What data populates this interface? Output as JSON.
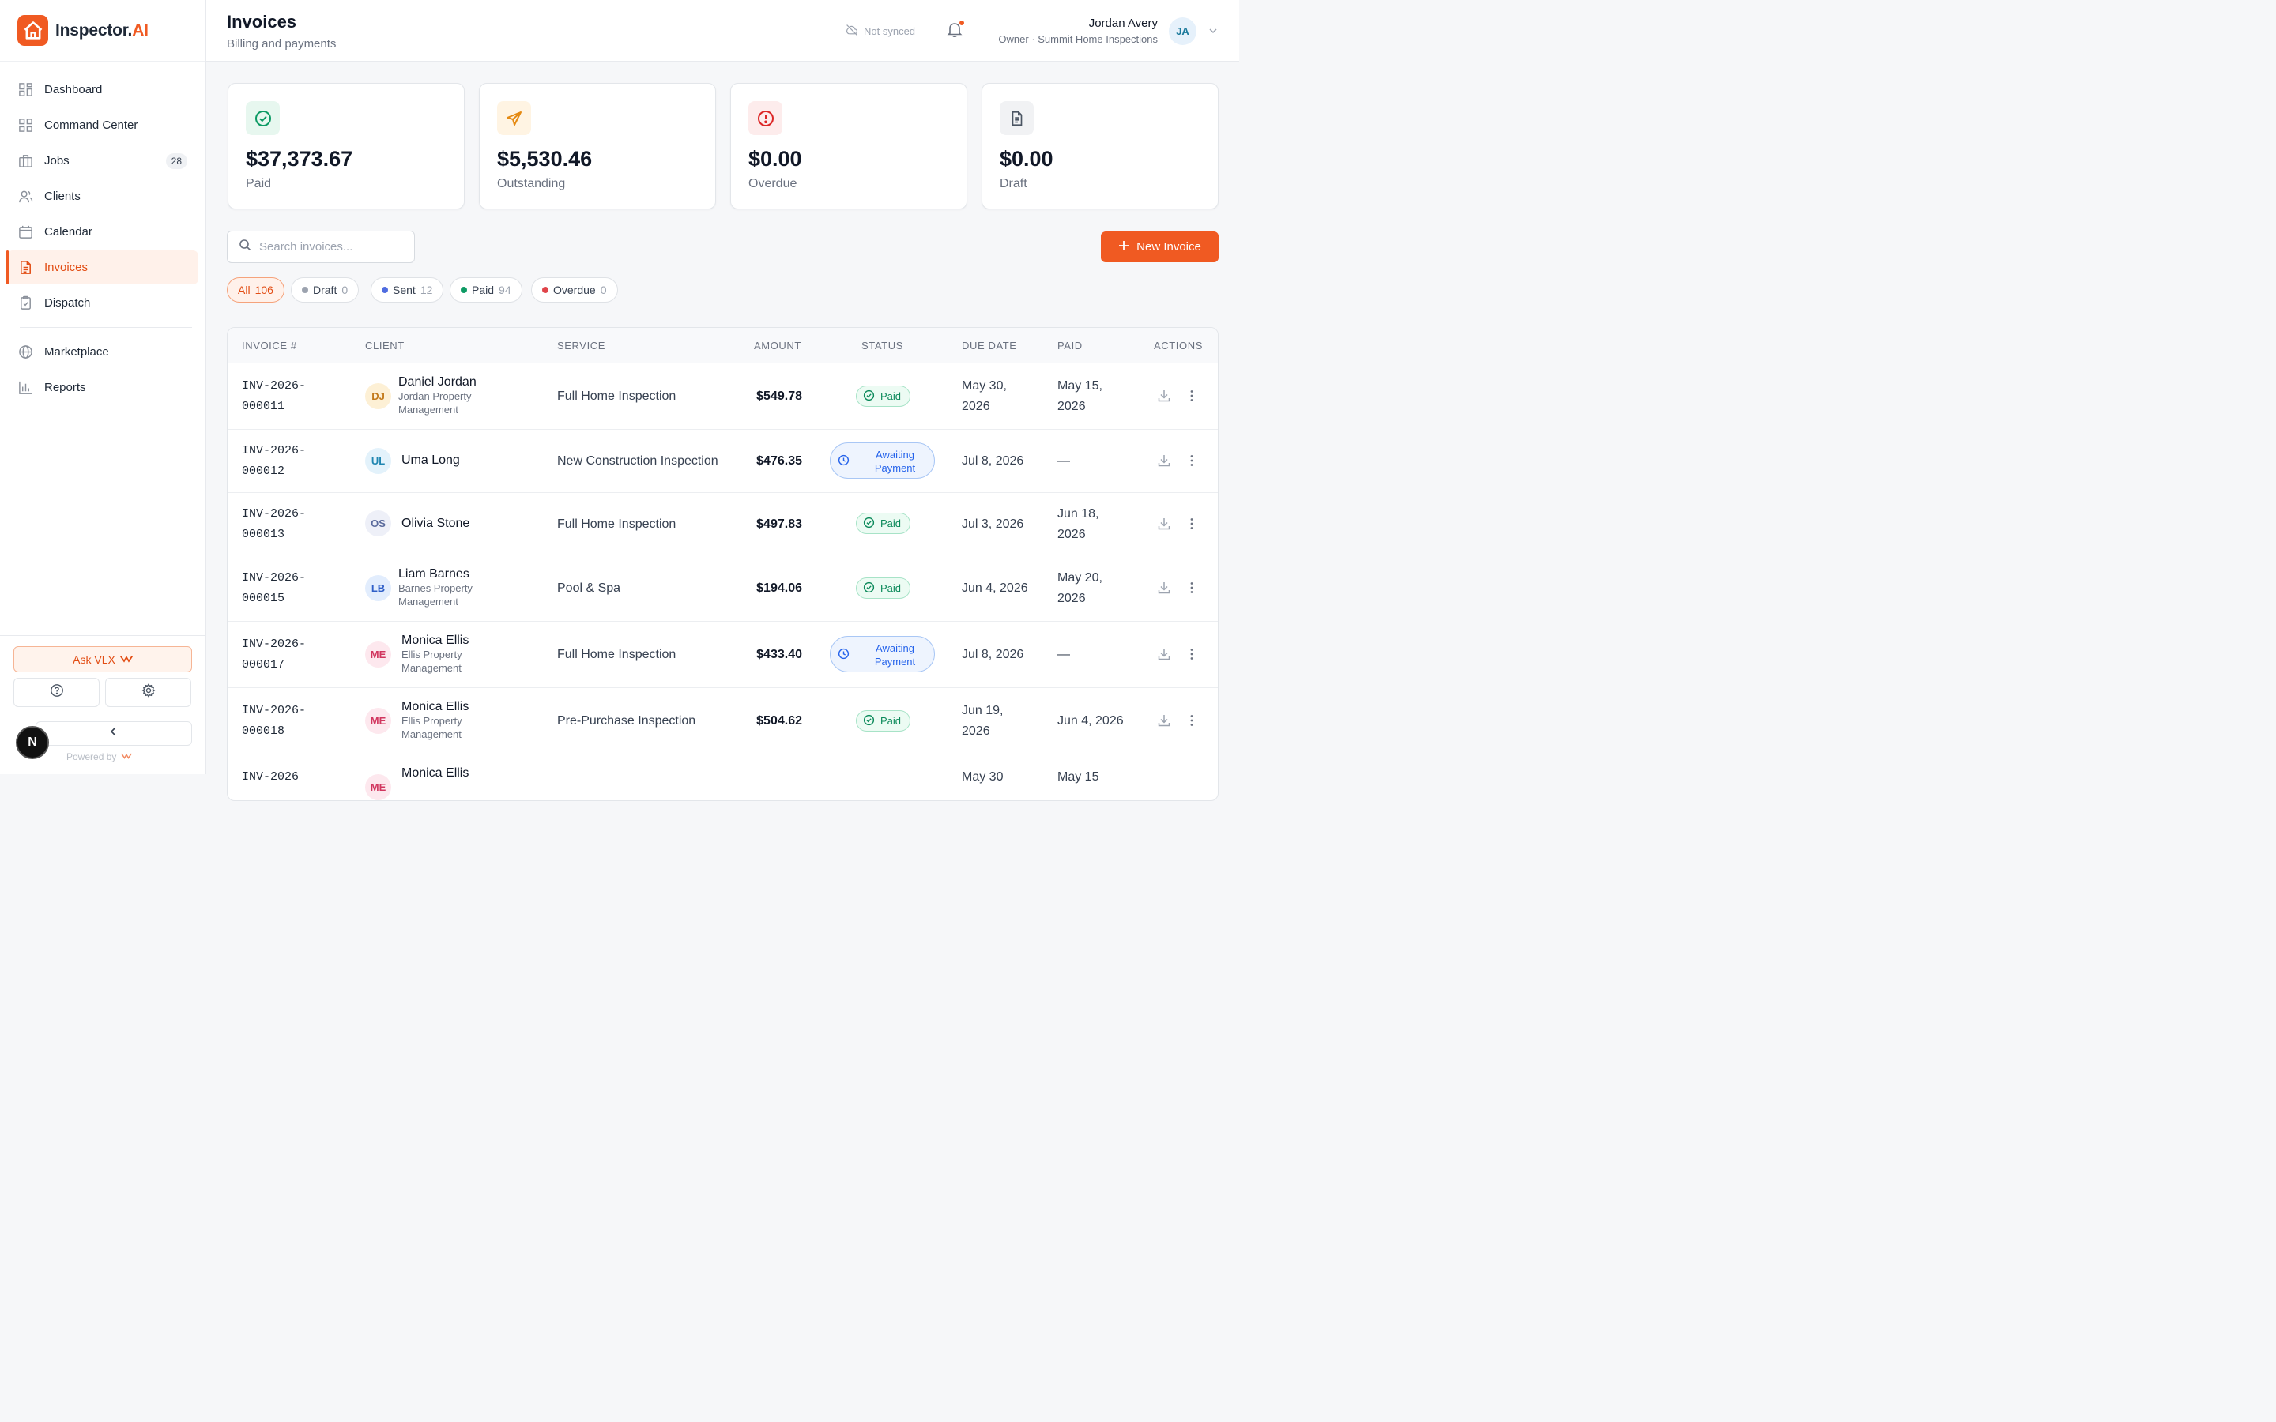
{
  "brand": {
    "name": "Inspector.",
    "suffix": "AI"
  },
  "sidebar": {
    "items": [
      {
        "label": "Dashboard",
        "icon": "grid-icon"
      },
      {
        "label": "Command Center",
        "icon": "grid-icon"
      },
      {
        "label": "Jobs",
        "icon": "building-icon",
        "badge": "28"
      },
      {
        "label": "Clients",
        "icon": "users-icon"
      },
      {
        "label": "Calendar",
        "icon": "calendar-icon"
      },
      {
        "label": "Invoices",
        "icon": "file-icon",
        "active": true
      },
      {
        "label": "Dispatch",
        "icon": "clipboard-icon"
      },
      {
        "label": "Marketplace",
        "icon": "globe-icon"
      },
      {
        "label": "Reports",
        "icon": "bar-chart-icon"
      }
    ],
    "ask_label": "Ask VLX",
    "avatar_initial": "N",
    "powered_by": "Powered by"
  },
  "header": {
    "title": "Invoices",
    "subtitle": "Billing and payments",
    "sync_status": "Not synced",
    "user_name": "Jordan Avery",
    "user_role": "Owner · Summit Home Inspections",
    "user_initials": "JA"
  },
  "stats": [
    {
      "amount": "$37,373.67",
      "label": "Paid",
      "icon": "check-circle-icon",
      "color": "#0d9a64",
      "bg": "#e7f7ef"
    },
    {
      "amount": "$5,530.46",
      "label": "Outstanding",
      "icon": "send-icon",
      "color": "#e58a12",
      "bg": "#fff4e3"
    },
    {
      "amount": "$0.00",
      "label": "Overdue",
      "icon": "alert-circle-icon",
      "color": "#dc2626",
      "bg": "#fdecec"
    },
    {
      "amount": "$0.00",
      "label": "Draft",
      "icon": "document-icon",
      "color": "#4b5563",
      "bg": "#f1f2f4"
    }
  ],
  "search": {
    "placeholder": "Search invoices..."
  },
  "new_invoice_label": "New Invoice",
  "filters": [
    {
      "label": "All",
      "count": "106",
      "active": true
    },
    {
      "label": "Draft",
      "count": "0",
      "dot": "#9ca3af"
    },
    {
      "label": "Sent",
      "count": "12",
      "dot": "#4f6ce0"
    },
    {
      "label": "Paid",
      "count": "94",
      "dot": "#0d9a64"
    },
    {
      "label": "Overdue",
      "count": "0",
      "dot": "#e0444a"
    }
  ],
  "table": {
    "columns": [
      "INVOICE #",
      "CLIENT",
      "SERVICE",
      "AMOUNT",
      "STATUS",
      "DUE DATE",
      "PAID",
      "ACTIONS"
    ],
    "rows": [
      {
        "inv1": "INV-2026-",
        "inv2": "000011",
        "initials": "DJ",
        "av_bg": "#fdf0d5",
        "av_fg": "#c2791a",
        "name": "Daniel Jordan",
        "company1": "Jordan Property",
        "company2": "Management",
        "service": "Full Home Inspection",
        "amount": "$549.78",
        "status": "Paid",
        "due1": "May 30,",
        "due2": "2026",
        "paid1": "May 15,",
        "paid2": "2026"
      },
      {
        "inv1": "INV-2026-",
        "inv2": "000012",
        "initials": "UL",
        "av_bg": "#e3f2fb",
        "av_fg": "#1f86b1",
        "name": "Uma Long",
        "company1": "",
        "company2": "",
        "service": "New Construction Inspection",
        "amount": "$476.35",
        "status": "Awaiting Payment",
        "status1": "Awaiting",
        "status2": "Payment",
        "due1": "Jul 8, 2026",
        "due2": "",
        "paid1": "—",
        "paid2": ""
      },
      {
        "inv1": "INV-2026-",
        "inv2": "000013",
        "initials": "OS",
        "av_bg": "#eef0f8",
        "av_fg": "#5a6a9c",
        "name": "Olivia Stone",
        "company1": "",
        "company2": "",
        "service": "Full Home Inspection",
        "amount": "$497.83",
        "status": "Paid",
        "due1": "Jul 3, 2026",
        "due2": "",
        "paid1": "Jun 18,",
        "paid2": "2026"
      },
      {
        "inv1": "INV-2026-",
        "inv2": "000015",
        "initials": "LB",
        "av_bg": "#e2edfd",
        "av_fg": "#2f5fc8",
        "name": "Liam Barnes",
        "company1": "Barnes Property",
        "company2": "Management",
        "service": "Pool & Spa",
        "amount": "$194.06",
        "status": "Paid",
        "due1": "Jun 4, 2026",
        "due2": "",
        "paid1": "May 20,",
        "paid2": "2026"
      },
      {
        "inv1": "INV-2026-",
        "inv2": "000017",
        "initials": "ME",
        "av_bg": "#fde8ee",
        "av_fg": "#d1365f",
        "name": "Monica Ellis",
        "company1": "Ellis Property",
        "company2": "Management",
        "service": "Full Home Inspection",
        "amount": "$433.40",
        "status": "Awaiting Payment",
        "status1": "Awaiting",
        "status2": "Payment",
        "due1": "Jul 8, 2026",
        "due2": "",
        "paid1": "—",
        "paid2": ""
      },
      {
        "inv1": "INV-2026-",
        "inv2": "000018",
        "initials": "ME",
        "av_bg": "#fde8ee",
        "av_fg": "#d1365f",
        "name": "Monica Ellis",
        "company1": "Ellis Property",
        "company2": "Management",
        "service": "Pre-Purchase Inspection",
        "amount": "$504.62",
        "status": "Paid",
        "due1": "Jun 19,",
        "due2": "2026",
        "paid1": "Jun 4, 2026",
        "paid2": ""
      },
      {
        "inv1": "INV-2026",
        "inv2": "",
        "initials": "ME",
        "av_bg": "#fde8ee",
        "av_fg": "#d1365f",
        "name": "Monica Ellis",
        "company1": "",
        "company2": "",
        "service": "",
        "amount": "",
        "status": "",
        "due1": "May 30",
        "due2": "",
        "paid1": "May 15",
        "paid2": ""
      }
    ]
  }
}
